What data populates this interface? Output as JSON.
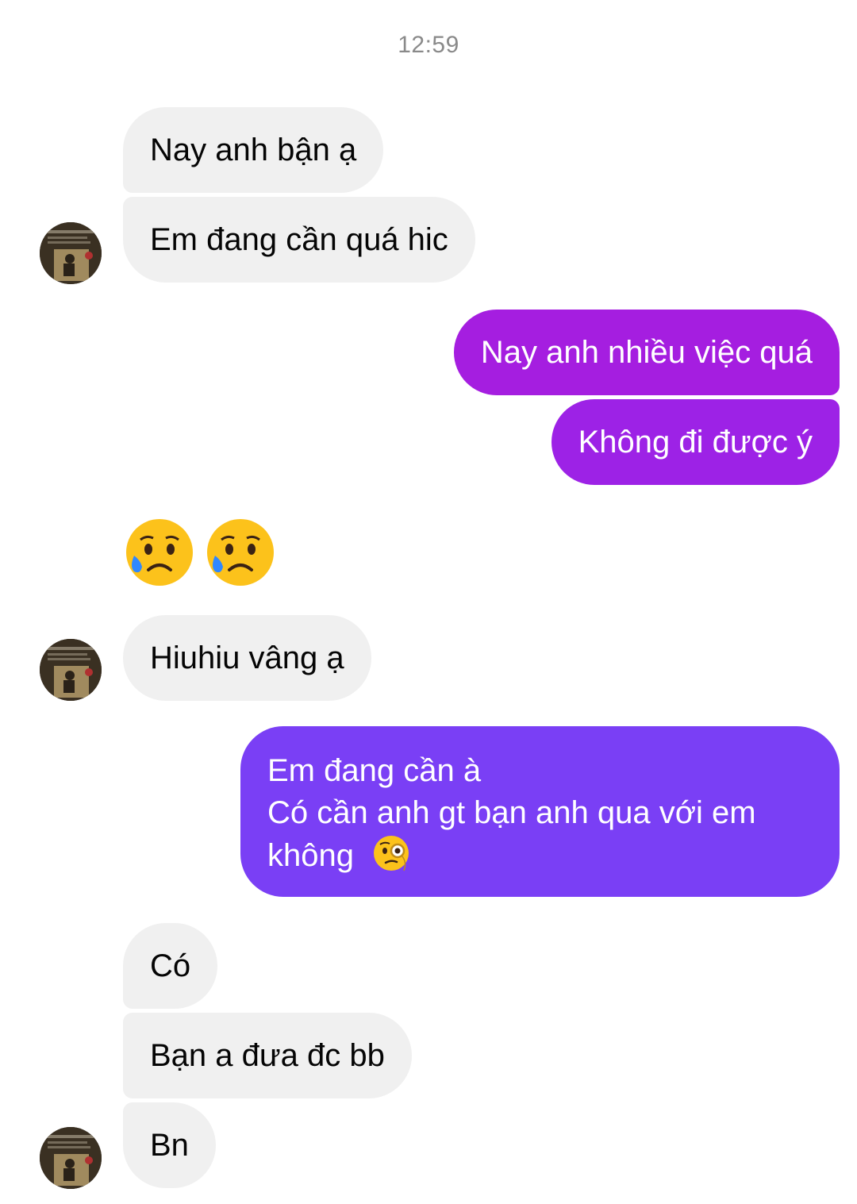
{
  "chat": {
    "timestamp": "12:59",
    "messages": [
      {
        "from": "them",
        "text": "Nay anh bận ạ"
      },
      {
        "from": "them",
        "text": "Em đang cần quá hic"
      },
      {
        "from": "me",
        "text": "Nay anh nhiều việc quá"
      },
      {
        "from": "me",
        "text": "Không đi được ý"
      },
      {
        "from": "them",
        "emoji": [
          "sad-but-relieved-face",
          "sad-but-relieved-face"
        ]
      },
      {
        "from": "them",
        "text": "Hiuhiu vâng ạ"
      },
      {
        "from": "me",
        "lines": [
          "Em đang cần à",
          "Có cần anh gt bạn anh qua với em",
          "không"
        ],
        "emoji": "face-with-monocle"
      },
      {
        "from": "them",
        "text": "Có"
      },
      {
        "from": "them",
        "text": "Bạn a đưa đc bb"
      },
      {
        "from": "them",
        "text": "Bn"
      }
    ]
  },
  "colors": {
    "incoming_bubble": "#f0f0f0",
    "outgoing_top": "#a51ee0",
    "outgoing_mid": "#9d22e6",
    "outgoing_bottom": "#7a3ff5",
    "timestamp": "#8a8a8a"
  }
}
